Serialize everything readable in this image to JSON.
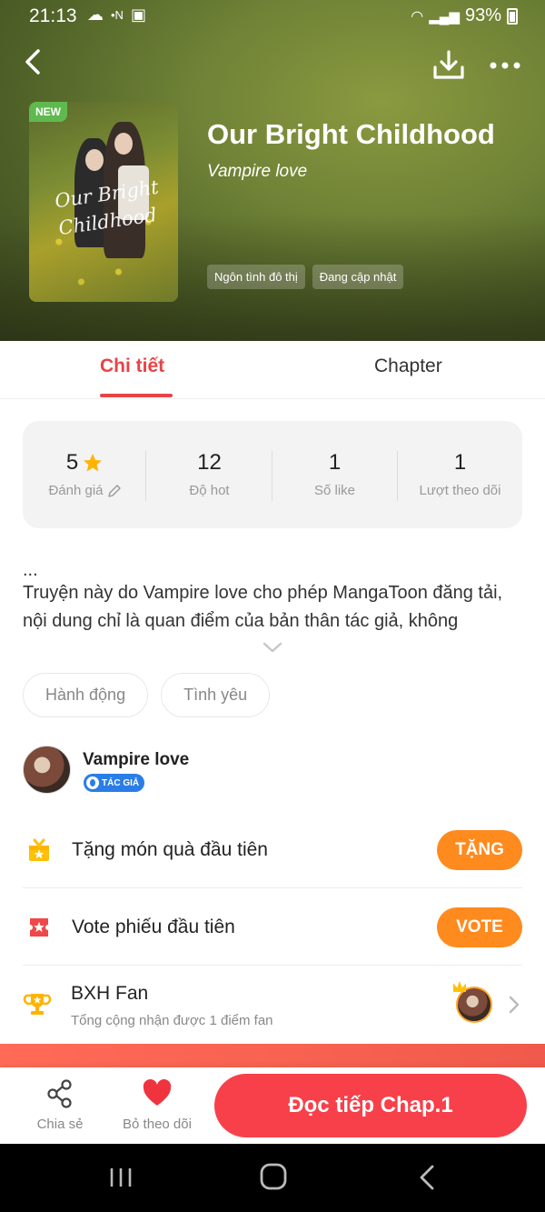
{
  "status_bar": {
    "time": "21:13",
    "battery": "93%"
  },
  "book": {
    "badge": "NEW",
    "cover_title": "Our Bright Childhood",
    "title": "Our Bright Childhood",
    "author": "Vampire love",
    "tags": [
      "Ngôn tình đô thị",
      "Đang cập nhật"
    ]
  },
  "tabs": {
    "detail": "Chi tiết",
    "chapter": "Chapter"
  },
  "stats": [
    {
      "value": "5",
      "label": "Đánh giá"
    },
    {
      "value": "12",
      "label": "Độ hot"
    },
    {
      "value": "1",
      "label": "Số like"
    },
    {
      "value": "1",
      "label": "Lượt theo dõi"
    }
  ],
  "description": {
    "ellipsis": "...",
    "text": "Truyện này do Vampire love cho phép MangaToon đăng tải, nội dung chỉ là quan điểm của bản thân tác giả, không"
  },
  "genres": [
    "Hành động",
    "Tình yêu"
  ],
  "author_section": {
    "name": "Vampire love",
    "badge": "TÁC GIẢ"
  },
  "actions": {
    "gift_label": "Tặng món quà đầu tiên",
    "gift_button": "TẶNG",
    "vote_label": "Vote phiếu đầu tiên",
    "vote_button": "VOTE",
    "fan_title": "BXH Fan",
    "fan_subtitle": "Tổng cộng nhận được 1 điểm fan"
  },
  "bottom_bar": {
    "share": "Chia sẻ",
    "unfollow": "Bỏ theo dõi",
    "read": "Đọc tiếp Chap.1"
  },
  "colors": {
    "accent": "#e74446",
    "orange": "#ff8a1e",
    "read_button": "#f7404a"
  }
}
